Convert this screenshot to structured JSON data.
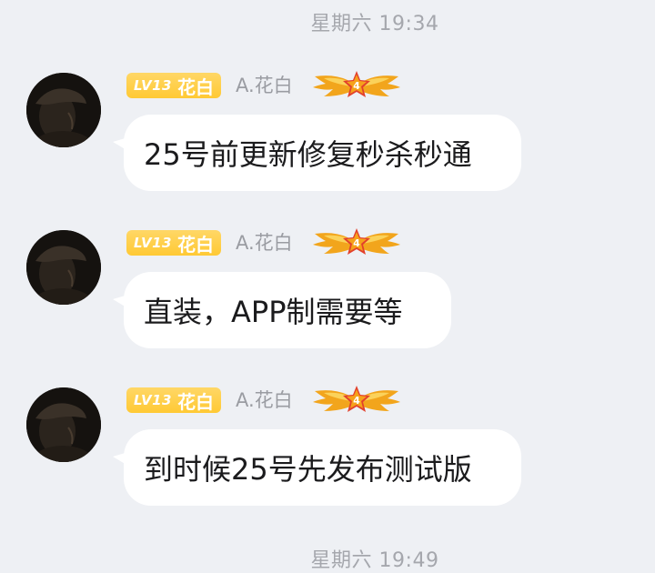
{
  "timestamps": {
    "top": "星期六 19:34",
    "bottom": "星期六 19:49"
  },
  "messages": [
    {
      "badge_level": "LV13",
      "badge_title": "花白",
      "nickname": "A.花白",
      "rank_icon": "rank-4-winged-star-icon",
      "text": "25号前更新修复秒杀秒通"
    },
    {
      "badge_level": "LV13",
      "badge_title": "花白",
      "nickname": "A.花白",
      "rank_icon": "rank-4-winged-star-icon",
      "text": "直装，APP制需要等"
    },
    {
      "badge_level": "LV13",
      "badge_title": "花白",
      "nickname": "A.花白",
      "rank_icon": "rank-4-winged-star-icon",
      "text": "到时候25号先发布测试版"
    }
  ],
  "rank_number": "4",
  "colors": {
    "background": "#eef0f4",
    "bubble": "#ffffff",
    "badge": "#ffcb3a",
    "nickname": "#9a9ca2",
    "timestamp": "#a5a7ad",
    "rank_gold": "#f2a51c",
    "rank_red": "#e2402c"
  }
}
